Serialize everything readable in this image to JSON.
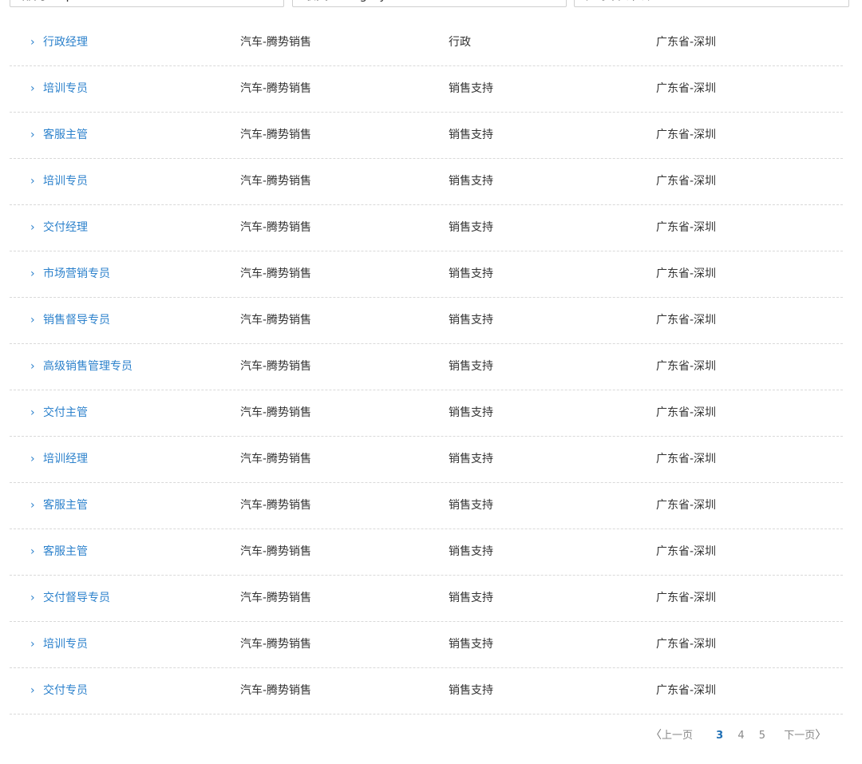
{
  "filters": {
    "department": "部门 Department",
    "category": "职类 Category",
    "location": "广东省-深圳"
  },
  "jobs": [
    {
      "title": "行政经理",
      "dept": "汽车-腾势销售",
      "category": "行政",
      "location": "广东省-深圳"
    },
    {
      "title": "培训专员",
      "dept": "汽车-腾势销售",
      "category": "销售支持",
      "location": "广东省-深圳"
    },
    {
      "title": "客服主管",
      "dept": "汽车-腾势销售",
      "category": "销售支持",
      "location": "广东省-深圳"
    },
    {
      "title": "培训专员",
      "dept": "汽车-腾势销售",
      "category": "销售支持",
      "location": "广东省-深圳"
    },
    {
      "title": "交付经理",
      "dept": "汽车-腾势销售",
      "category": "销售支持",
      "location": "广东省-深圳"
    },
    {
      "title": "市场营销专员",
      "dept": "汽车-腾势销售",
      "category": "销售支持",
      "location": "广东省-深圳"
    },
    {
      "title": "销售督导专员",
      "dept": "汽车-腾势销售",
      "category": "销售支持",
      "location": "广东省-深圳"
    },
    {
      "title": "高级销售管理专员",
      "dept": "汽车-腾势销售",
      "category": "销售支持",
      "location": "广东省-深圳"
    },
    {
      "title": "交付主管",
      "dept": "汽车-腾势销售",
      "category": "销售支持",
      "location": "广东省-深圳"
    },
    {
      "title": "培训经理",
      "dept": "汽车-腾势销售",
      "category": "销售支持",
      "location": "广东省-深圳"
    },
    {
      "title": "客服主管",
      "dept": "汽车-腾势销售",
      "category": "销售支持",
      "location": "广东省-深圳"
    },
    {
      "title": "客服主管",
      "dept": "汽车-腾势销售",
      "category": "销售支持",
      "location": "广东省-深圳"
    },
    {
      "title": "交付督导专员",
      "dept": "汽车-腾势销售",
      "category": "销售支持",
      "location": "广东省-深圳"
    },
    {
      "title": "培训专员",
      "dept": "汽车-腾势销售",
      "category": "销售支持",
      "location": "广东省-深圳"
    },
    {
      "title": "交付专员",
      "dept": "汽车-腾势销售",
      "category": "销售支持",
      "location": "广东省-深圳"
    }
  ],
  "icons": {
    "row_expand": "chevron-right-icon",
    "prev": "chevron-left-icon",
    "next": "chevron-right-icon"
  },
  "pagination": {
    "prev_label": "上一页",
    "pages": [
      "3",
      "4",
      "5"
    ],
    "current": "3",
    "next_label": "下一页"
  },
  "colors": {
    "link": "#2d82cc",
    "current_page": "#1f6fb5",
    "divider": "#d9d9d9"
  }
}
